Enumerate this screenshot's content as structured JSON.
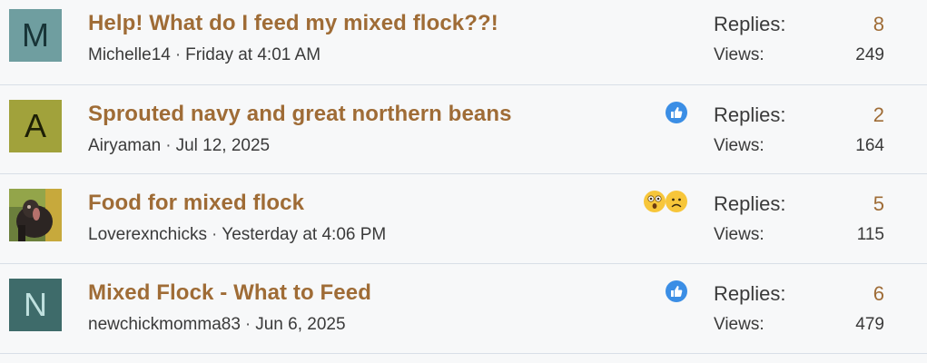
{
  "threads": [
    {
      "avatar_letter": "M",
      "avatar_bg": "#6f9ea0",
      "avatar_fg": "#183437",
      "title": "Help! What do I feed my mixed flock??!",
      "author": "Michelle14",
      "separator": "·",
      "date": "Friday at 4:01 AM",
      "reactions": [],
      "replies_label": "Replies:",
      "replies": "8",
      "views_label": "Views:",
      "views": "249"
    },
    {
      "avatar_letter": "A",
      "avatar_bg": "#a1a23b",
      "avatar_fg": "#1d1f06",
      "title": "Sprouted navy and great northern beans",
      "author": "Airyaman",
      "separator": "·",
      "date": "Jul 12, 2025",
      "reactions": [
        "like-icon"
      ],
      "replies_label": "Replies:",
      "replies": "2",
      "views_label": "Views:",
      "views": "164"
    },
    {
      "avatar_letter": "",
      "avatar_bg": "#5a6b3a",
      "avatar_fg": "#ffffff",
      "avatar_kind": "turkey-photo",
      "title": "Food for mixed flock",
      "author": "Loverexnchicks",
      "separator": "·",
      "date": "Yesterday at 4:06 PM",
      "reactions": [
        "wow-icon",
        "sad-icon"
      ],
      "replies_label": "Replies:",
      "replies": "5",
      "views_label": "Views:",
      "views": "115"
    },
    {
      "avatar_letter": "N",
      "avatar_bg": "#3e6b6a",
      "avatar_fg": "#bfe0de",
      "title": "Mixed Flock - What to Feed",
      "author": "newchickmomma83",
      "separator": "·",
      "date": "Jun 6, 2025",
      "reactions": [
        "like-icon"
      ],
      "replies_label": "Replies:",
      "replies": "6",
      "views_label": "Views:",
      "views": "479"
    }
  ]
}
